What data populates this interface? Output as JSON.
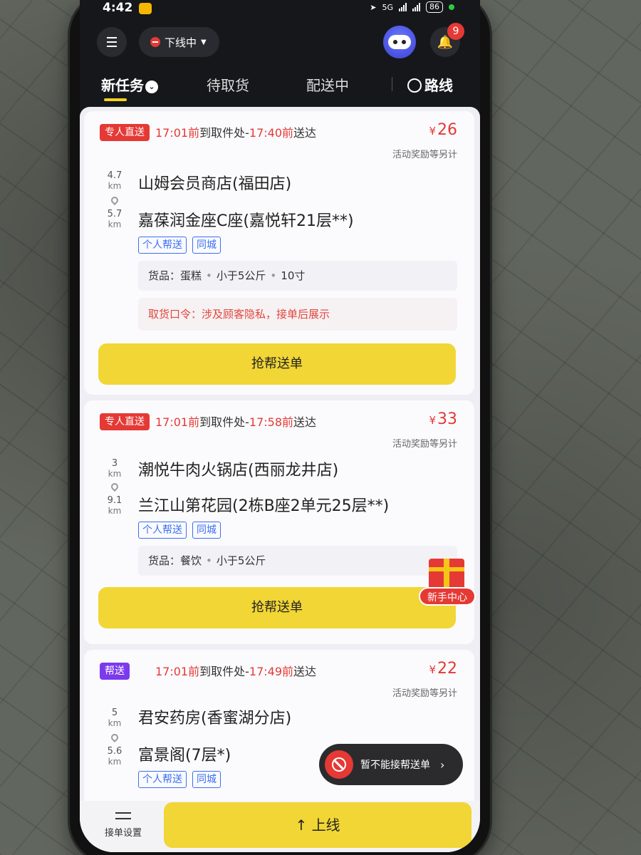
{
  "status_bar": {
    "time": "4:42",
    "network": "5G",
    "battery": "86"
  },
  "topbar": {
    "status_label": "下线中",
    "notification_count": "9"
  },
  "tabs": [
    {
      "label": "新任务"
    },
    {
      "label": "待取货"
    },
    {
      "label": "配送中"
    },
    {
      "label": "路线"
    }
  ],
  "orders": [
    {
      "badge": "专人直送",
      "badge_color": "#e53935",
      "pickup_time": "17:01前",
      "to_pickup": "到取件处-",
      "deliver_time": "17:40前",
      "deliver_suffix": "送达",
      "price_symbol": "¥",
      "price": "26",
      "reward_note": "活动奖励等另计",
      "dist_pickup": "4.7",
      "dist_deliver": "5.7",
      "km": "km",
      "pickup_addr": "山姆会员商店(福田店)",
      "deliver_addr": "嘉葆润金座C座(嘉悦轩21层**)",
      "tags": [
        "个人帮送",
        "同城"
      ],
      "goods": [
        "货品：蛋糕",
        "小于5公斤",
        "10寸"
      ],
      "pickup_code": "取货口令：涉及顾客隐私，接单后展示",
      "button": "抢帮送单"
    },
    {
      "badge": "专人直送",
      "badge_color": "#e53935",
      "pickup_time": "17:01前",
      "to_pickup": "到取件处-",
      "deliver_time": "17:58前",
      "deliver_suffix": "送达",
      "price_symbol": "¥",
      "price": "33",
      "reward_note": "活动奖励等另计",
      "dist_pickup": "3",
      "dist_deliver": "9.1",
      "km": "km",
      "pickup_addr": "潮悦牛肉火锅店(西丽龙井店)",
      "deliver_addr": "兰江山第花园(2栋B座2单元25层**)",
      "tags": [
        "个人帮送",
        "同城"
      ],
      "goods": [
        "货品：餐饮",
        "小于5公斤"
      ],
      "button": "抢帮送单"
    },
    {
      "badge": "帮送",
      "badge_color": "#7c3aed",
      "pickup_time": "17:01前",
      "to_pickup": "到取件处-",
      "deliver_time": "17:49前",
      "deliver_suffix": "送达",
      "price_symbol": "¥",
      "price": "22",
      "reward_note": "活动奖励等另计",
      "dist_pickup": "5",
      "dist_deliver": "5.6",
      "km": "km",
      "pickup_addr": "君安药房(香蜜湖分店)",
      "deliver_addr": "富景阁(7层*)",
      "tags": [
        "个人帮送",
        "同城"
      ]
    }
  ],
  "gift": {
    "label": "新手中心"
  },
  "toast": {
    "text": "暂不能接帮送单"
  },
  "bottom": {
    "settings_label": "接单设置",
    "online_button": "上线"
  },
  "colors": {
    "accent_yellow": "#f1d635",
    "alert_red": "#e53935",
    "tag_blue": "#3b6ff5"
  },
  "icons": [
    "menu-icon",
    "robot-assistant-icon",
    "bell-icon",
    "chevron-down-icon",
    "route-icon",
    "location-pin-icon",
    "gift-icon",
    "no-entry-icon",
    "chevron-right-icon",
    "settings-sliders-icon",
    "arrow-up-icon"
  ]
}
